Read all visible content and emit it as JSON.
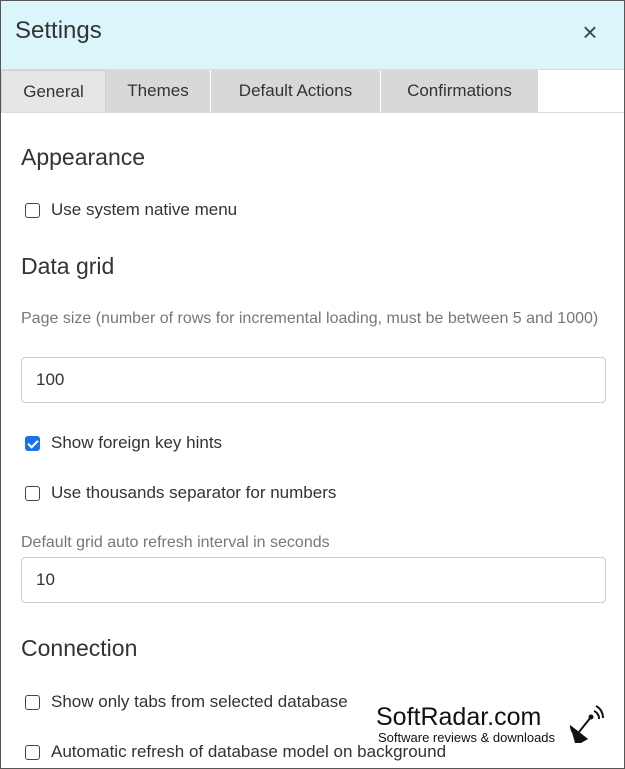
{
  "dialog": {
    "title": "Settings",
    "close_glyph": "×"
  },
  "tabs": [
    {
      "label": "General",
      "active": true
    },
    {
      "label": "Themes",
      "active": false
    },
    {
      "label": "Default Actions",
      "active": false
    },
    {
      "label": "Confirmations",
      "active": false
    }
  ],
  "appearance": {
    "title": "Appearance",
    "native_menu": {
      "label": "Use system native menu",
      "checked": false
    }
  },
  "data_grid": {
    "title": "Data grid",
    "page_size": {
      "label": "Page size (number of rows for incremental loading, must be between 5 and 1000)",
      "value": "100"
    },
    "foreign_key_hints": {
      "label": "Show foreign key hints",
      "checked": true
    },
    "thousands_separator": {
      "label": "Use thousands separator for numbers",
      "checked": false
    },
    "refresh_interval": {
      "label": "Default grid auto refresh interval in seconds",
      "value": "10"
    }
  },
  "connection": {
    "title": "Connection",
    "selected_db_tabs": {
      "label": "Show only tabs from selected database",
      "checked": false
    },
    "auto_refresh_model": {
      "label": "Automatic refresh of database model on background",
      "checked": false
    }
  },
  "watermark": {
    "title": "SoftRadar.com",
    "subtitle": "Software reviews & downloads",
    "icon": "satellite-dish-icon"
  }
}
